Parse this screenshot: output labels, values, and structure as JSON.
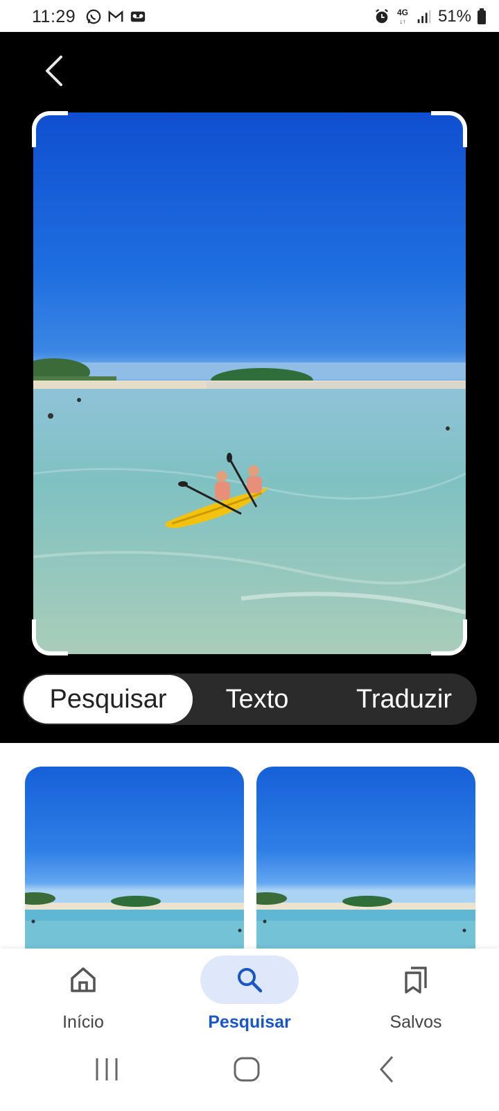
{
  "status_bar": {
    "time": "11:29",
    "battery": "51%",
    "network": "4G",
    "left_icons": [
      "whatsapp-icon",
      "gmail-icon",
      "voicemail-icon"
    ],
    "right_icons": [
      "alarm-icon",
      "signal-icon",
      "battery-icon"
    ]
  },
  "header": {
    "back_icon": "chevron-left-icon"
  },
  "modes": {
    "tabs": [
      "Pesquisar",
      "Texto",
      "Traduzir"
    ],
    "selected": "Pesquisar"
  },
  "bottom_nav": {
    "items": [
      {
        "label": "Início",
        "icon": "home-icon"
      },
      {
        "label": "Pesquisar",
        "icon": "search-icon"
      },
      {
        "label": "Salvos",
        "icon": "bookmarks-icon"
      }
    ],
    "active": "Pesquisar"
  },
  "system_nav": [
    "recents-button",
    "home-button",
    "back-button"
  ],
  "colors": {
    "accent": "#1a56c8",
    "active_pill": "#dfe8fb",
    "dark_bg": "#000000",
    "tab_bar_bg": "#2b2b2b"
  }
}
